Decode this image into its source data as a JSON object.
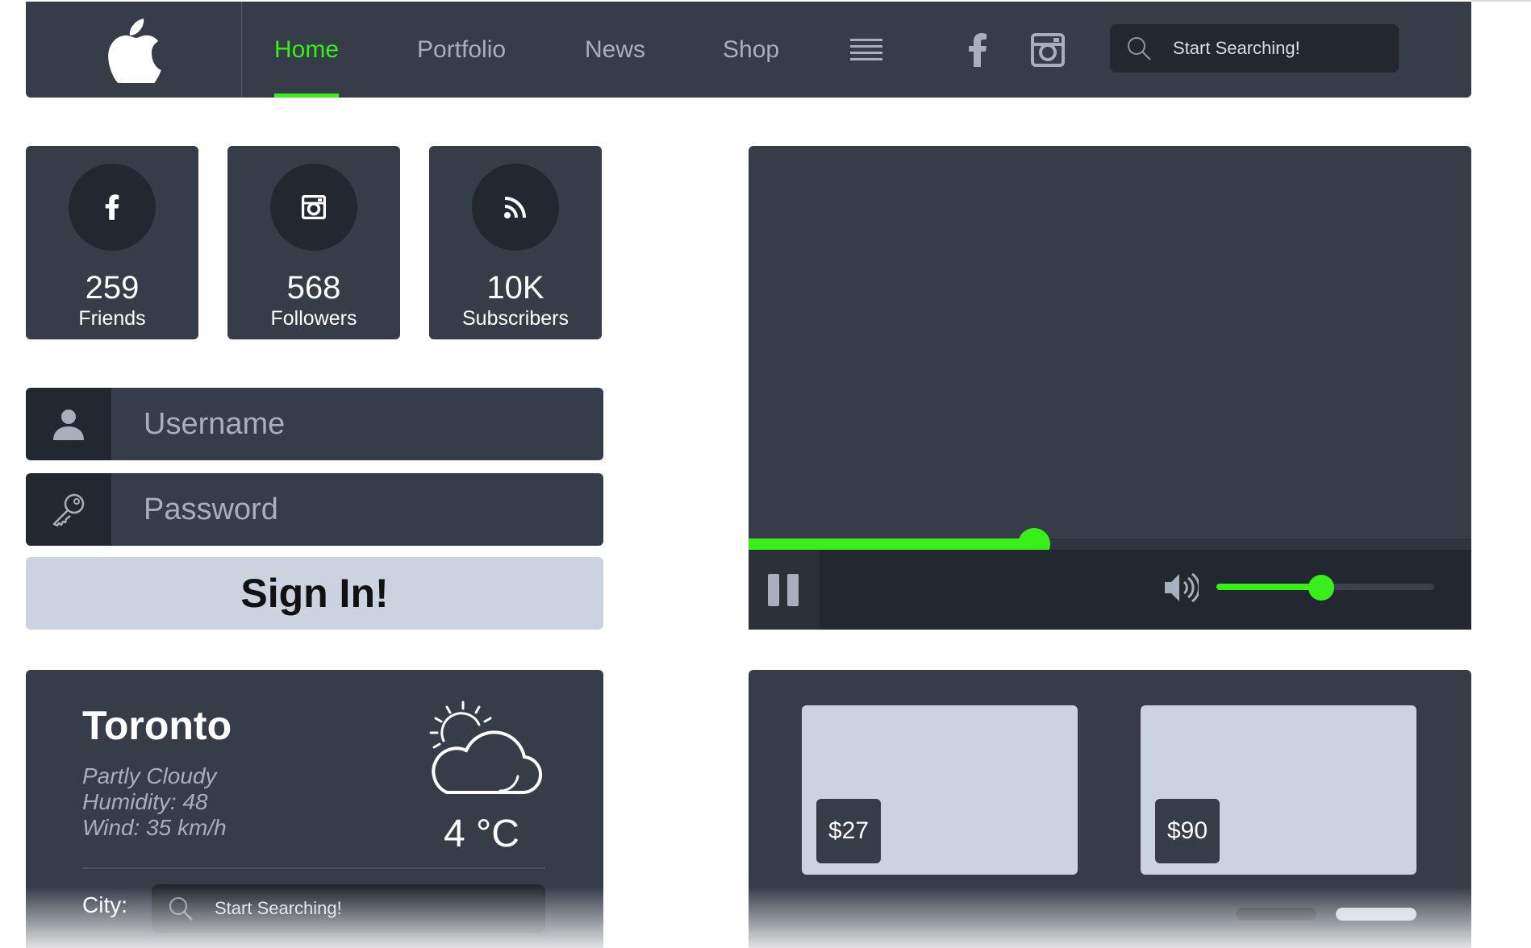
{
  "nav": {
    "links": [
      {
        "label": "Home",
        "active": true
      },
      {
        "label": "Portfolio",
        "active": false
      },
      {
        "label": "News",
        "active": false
      },
      {
        "label": "Shop",
        "active": false
      }
    ],
    "search_placeholder": "Start Searching!",
    "icons": [
      "apple-logo-icon",
      "hamburger-menu-icon",
      "facebook-icon",
      "instagram-icon",
      "search-icon"
    ]
  },
  "stats": [
    {
      "icon": "facebook-icon",
      "value": "259",
      "label": "Friends"
    },
    {
      "icon": "instagram-icon",
      "value": "568",
      "label": "Followers"
    },
    {
      "icon": "rss-icon",
      "value": "10K",
      "label": "Subscribers"
    }
  ],
  "login": {
    "username_placeholder": "Username",
    "password_placeholder": "Password",
    "signin_label": "Sign In!"
  },
  "video": {
    "progress": 0.395,
    "volume": 0.48,
    "state": "playing"
  },
  "weather": {
    "city": "Toronto",
    "condition": "Partly Cloudy",
    "humidity": "Humidity: 48",
    "wind": "Wind: 35 km/h",
    "temperature": "4 °C",
    "city_label": "City:",
    "search_placeholder": "Start Searching!",
    "icon": "partly-cloudy-icon"
  },
  "shop": {
    "products": [
      {
        "price": "$27"
      },
      {
        "price": "$90"
      }
    ],
    "page_indicators": 2,
    "active_indicator": 1
  },
  "colors": {
    "accent": "#39ef1a",
    "panel": "#363c48",
    "panel_dark": "#232830",
    "light_card": "#cbd3df",
    "muted_text": "#a7afbd"
  }
}
